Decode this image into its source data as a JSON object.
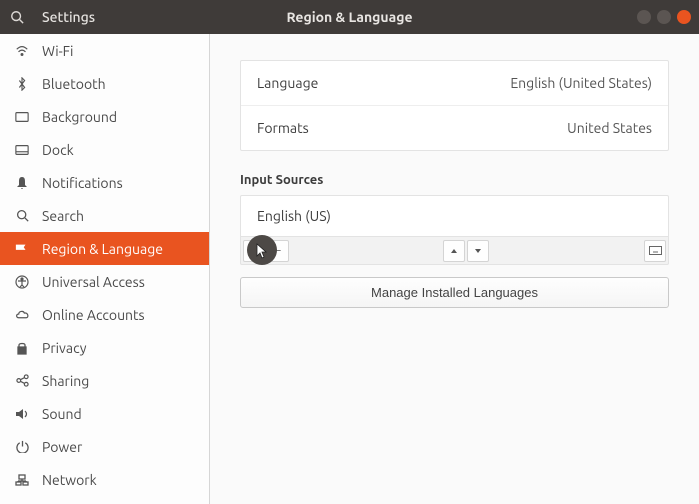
{
  "titlebar": {
    "app": "Settings",
    "title": "Region & Language"
  },
  "sidebar": {
    "items": [
      {
        "label": "Wi-Fi",
        "icon": "wifi"
      },
      {
        "label": "Bluetooth",
        "icon": "bluetooth"
      },
      {
        "label": "Background",
        "icon": "background"
      },
      {
        "label": "Dock",
        "icon": "dock"
      },
      {
        "label": "Notifications",
        "icon": "bell"
      },
      {
        "label": "Search",
        "icon": "search"
      },
      {
        "label": "Region & Language",
        "icon": "flag",
        "selected": true
      },
      {
        "label": "Universal Access",
        "icon": "universal"
      },
      {
        "label": "Online Accounts",
        "icon": "cloud"
      },
      {
        "label": "Privacy",
        "icon": "lock"
      },
      {
        "label": "Sharing",
        "icon": "share"
      },
      {
        "label": "Sound",
        "icon": "sound"
      },
      {
        "label": "Power",
        "icon": "power"
      },
      {
        "label": "Network",
        "icon": "network"
      }
    ]
  },
  "region": {
    "language_label": "Language",
    "language_value": "English (United States)",
    "formats_label": "Formats",
    "formats_value": "United States"
  },
  "input_sources": {
    "heading": "Input Sources",
    "items": [
      {
        "label": "English (US)"
      }
    ],
    "manage_label": "Manage Installed Languages"
  }
}
